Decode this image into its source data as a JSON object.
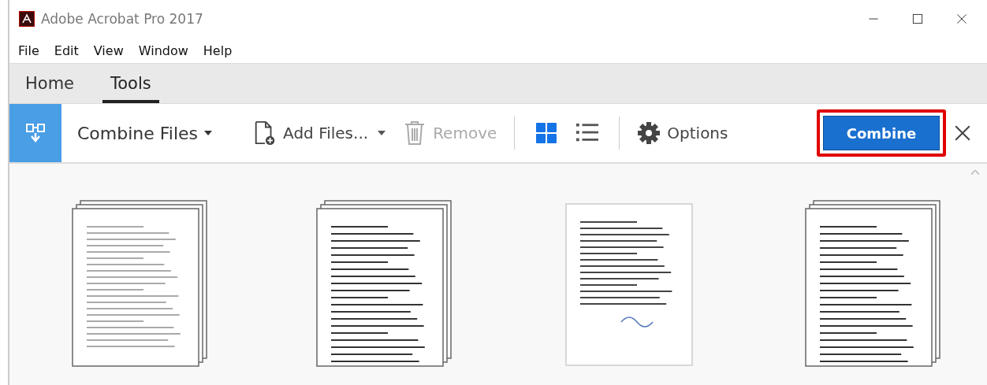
{
  "window": {
    "title": "Adobe Acrobat Pro 2017"
  },
  "menu": [
    "File",
    "Edit",
    "View",
    "Window",
    "Help"
  ],
  "tabs": [
    {
      "label": "Home",
      "selected": false
    },
    {
      "label": "Tools",
      "selected": true
    }
  ],
  "toolbar": {
    "title": "Combine Files",
    "add_files": "Add Files...",
    "remove": {
      "label": "Remove",
      "disabled": true
    },
    "views": [
      {
        "kind": "grid",
        "selected": true
      },
      {
        "kind": "list",
        "selected": false
      }
    ],
    "options": "Options",
    "combine": "Combine",
    "combine_highlighted": true
  },
  "files": [
    {
      "stacked": true
    },
    {
      "stacked": true
    },
    {
      "stacked": false
    },
    {
      "stacked": true
    }
  ]
}
